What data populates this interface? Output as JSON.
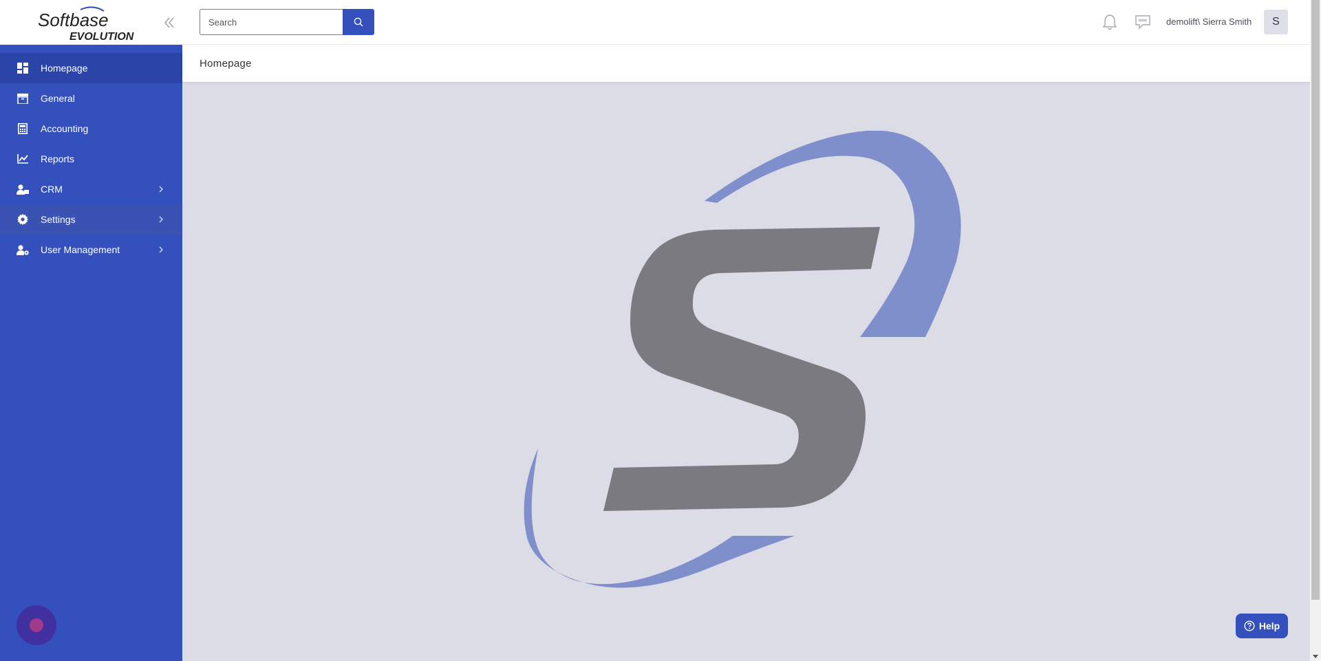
{
  "brand": {
    "logo_text_top": "Softbase",
    "logo_text_bottom": "EVOLUTION"
  },
  "sidebar": {
    "items": [
      {
        "label": "Homepage",
        "icon": "dashboard-icon",
        "active": true,
        "has_children": false
      },
      {
        "label": "General",
        "icon": "archive-box-icon",
        "active": false,
        "has_children": false
      },
      {
        "label": "Accounting",
        "icon": "calculator-icon",
        "active": false,
        "has_children": false
      },
      {
        "label": "Reports",
        "icon": "line-chart-icon",
        "active": false,
        "has_children": false
      },
      {
        "label": "CRM",
        "icon": "user-card-icon",
        "active": false,
        "has_children": true
      },
      {
        "label": "Settings",
        "icon": "gear-icon",
        "active": false,
        "has_children": true,
        "hovered": true
      },
      {
        "label": "User Management",
        "icon": "user-cog-icon",
        "active": false,
        "has_children": true
      }
    ]
  },
  "header": {
    "search_placeholder": "Search",
    "search_value": "",
    "user_label": "demolift\\ Sierra Smith",
    "avatar_initial": "S"
  },
  "breadcrumb": {
    "title": "Homepage"
  },
  "help": {
    "label": "Help"
  },
  "colors": {
    "primary": "#3450bd",
    "primary_dark": "#2a44a8",
    "content_bg": "#dcdce6",
    "watermark_gray": "#7b7a80",
    "watermark_blue": "#7f8fcc"
  }
}
